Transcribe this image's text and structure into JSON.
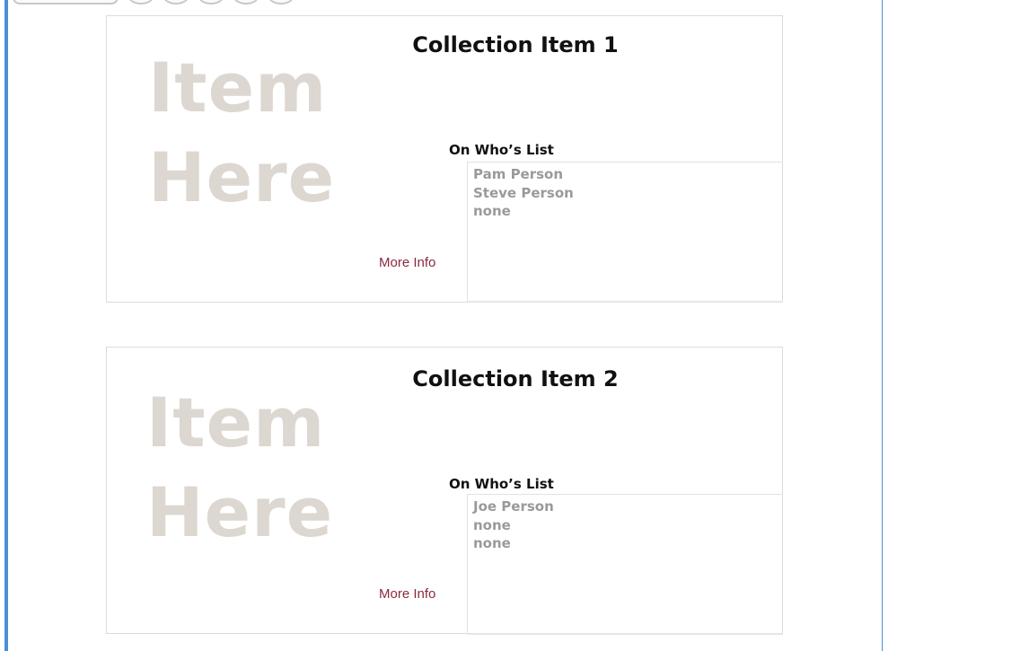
{
  "colors": {
    "accent_rule": "#4a90d9",
    "placeholder_text": "#ddd7d1",
    "link": "#8a2a3e",
    "list_text": "#9a9a9a"
  },
  "items": [
    {
      "title": "Collection Item 1",
      "placeholder_line1": "Item",
      "placeholder_line2": "Here",
      "list_heading": "On Who’s List",
      "list": [
        "Pam Person",
        "Steve Person",
        "none"
      ],
      "more_info_label": "More Info"
    },
    {
      "title": "Collection Item 2",
      "placeholder_line1": "Item",
      "placeholder_line2": "Here",
      "list_heading": "On Who’s List",
      "list": [
        "Joe Person",
        "none",
        "none"
      ],
      "more_info_label": "More Info"
    }
  ]
}
